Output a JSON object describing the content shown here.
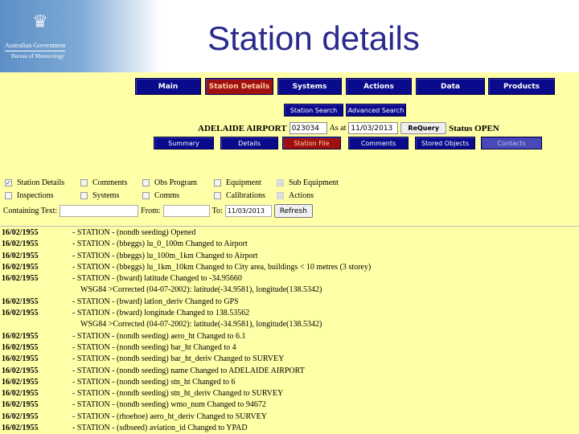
{
  "header": {
    "title": "Station details",
    "logo_line1": "Australian Government",
    "logo_line2": "Bureau of Meteorology"
  },
  "nav": [
    {
      "label": "Main"
    },
    {
      "label": "Station Details",
      "active": true
    },
    {
      "label": "Systems"
    },
    {
      "label": "Actions"
    },
    {
      "label": "Data"
    },
    {
      "label": "Products"
    }
  ],
  "search": {
    "station_search": "Station Search",
    "advanced_search": "Advanced Search"
  },
  "station": {
    "name": "ADELAIDE AIRPORT",
    "id": "023034",
    "as_at_label": "As at",
    "as_at": "11/03/2013",
    "requery": "ReQuery",
    "status": "Status OPEN"
  },
  "subnav": [
    {
      "label": "Summary"
    },
    {
      "label": "Details"
    },
    {
      "label": "Station File",
      "active": true
    },
    {
      "label": "Comments"
    },
    {
      "label": "Stored Objects"
    },
    {
      "label": "Contacts",
      "disabled": true
    }
  ],
  "checkboxes": [
    {
      "label": "Station Details",
      "checked": true
    },
    {
      "label": "Comments"
    },
    {
      "label": "Obs Program"
    },
    {
      "label": "Equipment"
    },
    {
      "label": "Sub Equipment",
      "disabled": true
    },
    {
      "label": "Inspections"
    },
    {
      "label": "Systems"
    },
    {
      "label": "Comms"
    },
    {
      "label": "Calibrations"
    },
    {
      "label": "Actions",
      "disabled": true
    }
  ],
  "filter": {
    "containing_label": "Containing Text:",
    "containing": "",
    "from_label": "From:",
    "from": "",
    "to_label": "To:",
    "to": "11/03/2013",
    "refresh": "Refresh"
  },
  "log": [
    {
      "date": "16/02/1955",
      "text": "- STATION - (nondb seeding) Opened"
    },
    {
      "date": "16/02/1955",
      "text": "- STATION - (bbeggs) lu_0_100m Changed to Airport"
    },
    {
      "date": "16/02/1955",
      "text": "- STATION - (bbeggs) lu_100m_1km Changed to Airport"
    },
    {
      "date": "16/02/1955",
      "text": "- STATION - (bbeggs) lu_1km_10km Changed to City area, buildings < 10 metres (3 storey)"
    },
    {
      "date": "16/02/1955",
      "text": "- STATION - (bward) latitude Changed to -34.95660"
    },
    {
      "date": "",
      "text": "WSG84 >Corrected (04-07-2002): latitude(-34.9581), longitude(138.5342)"
    },
    {
      "date": "16/02/1955",
      "text": "- STATION - (bward) latlon_deriv Changed to GPS"
    },
    {
      "date": "16/02/1955",
      "text": "- STATION - (bward) longitude Changed to 138.53562"
    },
    {
      "date": "",
      "text": "WSG84 >Corrected (04-07-2002): latitude(-34.9581), longitude(138.5342)"
    },
    {
      "date": "16/02/1955",
      "text": "- STATION - (nondb seeding) aero_ht Changed to 6.1"
    },
    {
      "date": "16/02/1955",
      "text": "- STATION - (nondb seeding) bar_ht Changed to 4"
    },
    {
      "date": "16/02/1955",
      "text": "- STATION - (nondb seeding) bar_ht_deriv Changed to SURVEY"
    },
    {
      "date": "16/02/1955",
      "text": "- STATION - (nondb seeding) name Changed to ADELAIDE AIRPORT"
    },
    {
      "date": "16/02/1955",
      "text": "- STATION - (nondb seeding) stn_ht Changed to 6"
    },
    {
      "date": "16/02/1955",
      "text": "- STATION - (nondb seeding) stn_ht_deriv Changed to SURVEY"
    },
    {
      "date": "16/02/1955",
      "text": "- STATION - (nondb seeding) wmo_num Changed to 94672"
    },
    {
      "date": "16/02/1955",
      "text": "- STATION - (rhoehoe) aero_ht_deriv Changed to SURVEY"
    },
    {
      "date": "16/02/1955",
      "text": "- STATION - (sdbseed) aviation_id Changed to YPAD"
    }
  ]
}
